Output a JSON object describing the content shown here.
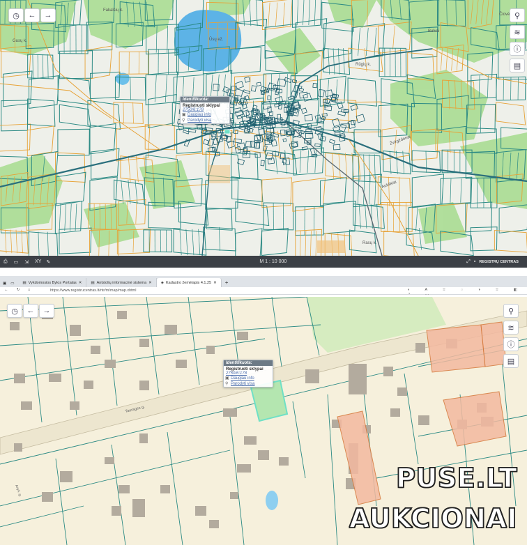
{
  "colors": {
    "parcel_line": "#2b8a84",
    "parcel_dark": "#1f5f6f",
    "road_orange": "#e7a236",
    "forest": "#9fd78a",
    "lake": "#5db3e6",
    "highlight": "#6fe0c6",
    "orange_fill": "#f4b79a",
    "bottom_ground": "#f6f0dc",
    "building": "#b3ab9e"
  },
  "top_map": {
    "place_labels": [
      "Fakalšių k.",
      "Ūsų ež.",
      "Gusų k.",
      "Rūgių k.",
      "Bulvai",
      "Čiovė",
      "Žvirgždenai",
      "Aukškiai",
      "Rasų k."
    ],
    "popup": {
      "header": "Identifikuota:",
      "title": "Registruoti sklypai",
      "parcel": "2750/6:178",
      "action_info": "Daugiau info",
      "action_show": "Parodyti visą"
    },
    "statusbar": {
      "xy_label": "XY",
      "scale": "M 1 : 10 000",
      "brand": "REGISTRŲ CENTRAS"
    }
  },
  "browser": {
    "tabs": [
      {
        "title": "Vykdomosios Bylos Portalas",
        "icon": "doc-icon"
      },
      {
        "title": "Antstolių informacinė sistema",
        "icon": "doc-icon"
      },
      {
        "title": "Kadastro žemėlapis 4.1.25",
        "icon": "map-icon"
      }
    ],
    "address": "https://www.registrucentras.lt/ntr/m/map/map.xhtml"
  },
  "bottom_map": {
    "popup": {
      "header": "Identifikuota:",
      "title": "Registruoti sklypai",
      "parcel": "2750/6:178",
      "action_info": "Daugiau info",
      "action_show": "Parodyti visą"
    },
    "street_label": "Taurages g.",
    "street_label_2": "Anyk. g."
  },
  "watermark": {
    "line1": "PUSE.LT",
    "line2": "AUKCIONAI"
  }
}
